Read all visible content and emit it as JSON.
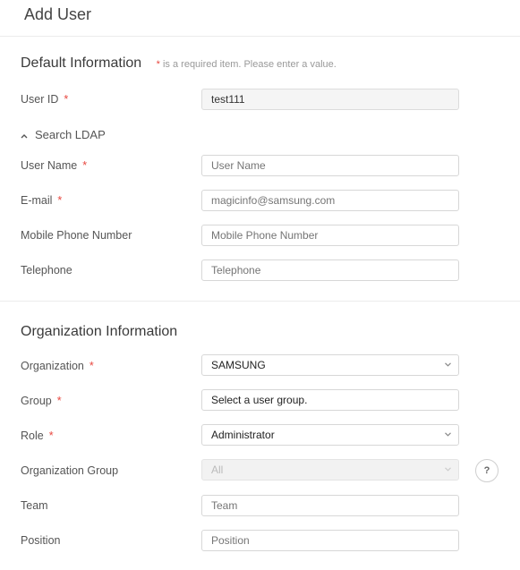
{
  "page": {
    "title": "Add User"
  },
  "default_info": {
    "heading": "Default Information",
    "required_star": "*",
    "required_note": "is a required item. Please enter a value.",
    "fields": {
      "user_id": {
        "label": "User ID",
        "value": "test111"
      },
      "ldap": {
        "label": "Search LDAP"
      },
      "user_name": {
        "label": "User Name",
        "placeholder": "User Name"
      },
      "email": {
        "label": "E-mail",
        "placeholder": "magicinfo@samsung.com"
      },
      "mobile": {
        "label": "Mobile Phone Number",
        "placeholder": "Mobile Phone Number"
      },
      "telephone": {
        "label": "Telephone",
        "placeholder": "Telephone"
      }
    }
  },
  "org_info": {
    "heading": "Organization Information",
    "fields": {
      "organization": {
        "label": "Organization",
        "value": "SAMSUNG"
      },
      "group": {
        "label": "Group",
        "value": "Select a user group."
      },
      "role": {
        "label": "Role",
        "value": "Administrator"
      },
      "org_group": {
        "label": "Organization Group",
        "value": "All",
        "help": "?"
      },
      "team": {
        "label": "Team",
        "placeholder": "Team"
      },
      "position": {
        "label": "Position",
        "placeholder": "Position"
      }
    }
  },
  "colors": {
    "required": "#e8473f",
    "border": "#d7d7d7"
  },
  "icons": {
    "ldap_toggle": "chevron-up-icon",
    "select_arrow": "chevron-down-icon",
    "help": "help-icon"
  }
}
